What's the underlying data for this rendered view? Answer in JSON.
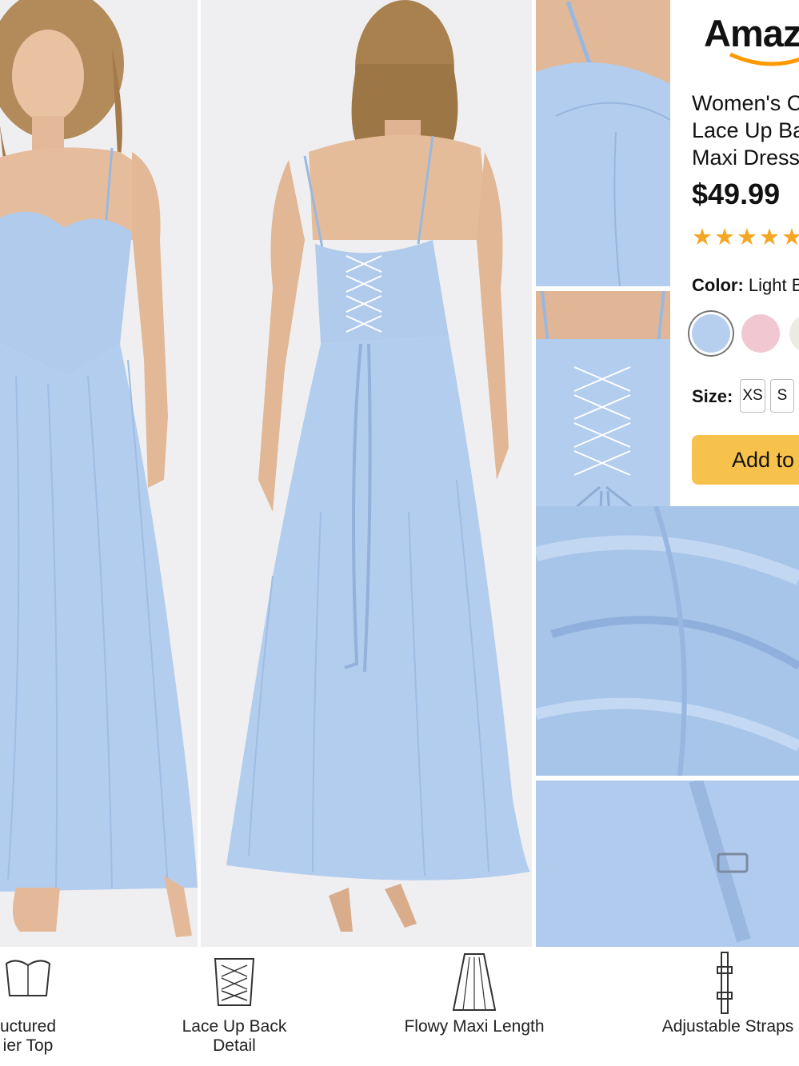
{
  "brand": {
    "logo_text": "Amaz"
  },
  "product": {
    "title_lines": [
      "Women's C",
      "Lace Up Ba",
      "Maxi Dress"
    ],
    "price": "$49.99",
    "stars": "★★★★★",
    "color_label": "Color:",
    "color_value": "Light B",
    "size_label": "Size:",
    "sizes": [
      "XS",
      "S"
    ],
    "add_button": "Add to"
  },
  "swatches": [
    "#b7cfee",
    "#f1c8d1",
    "#ecebe3"
  ],
  "features": [
    {
      "line1": "uctured",
      "line2": "ier Top"
    },
    {
      "line1": "Lace Up Back",
      "line2": "Detail"
    },
    {
      "line1": "Flowy Maxi Length",
      "line2": ""
    },
    {
      "line1": "Adjustable Straps",
      "line2": ""
    }
  ],
  "colors": {
    "dress": "#b3cdee",
    "button": "#f7c24b",
    "stars": "#f5a623",
    "brand_smile": "#ff9900"
  }
}
